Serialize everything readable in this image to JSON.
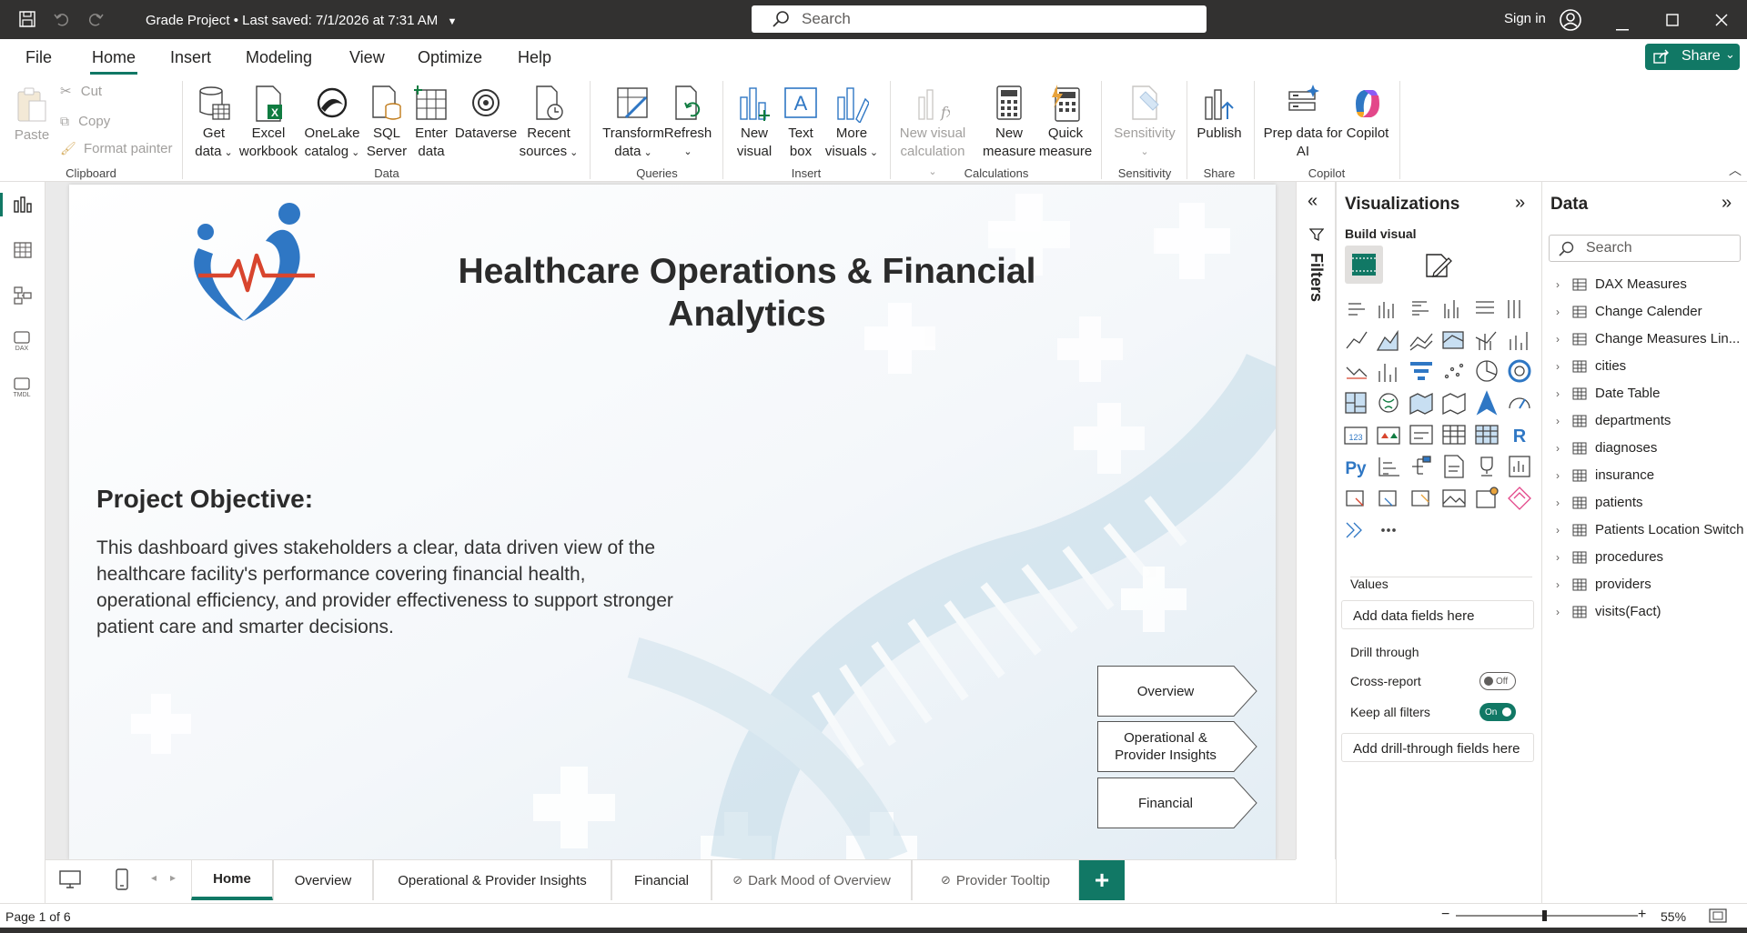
{
  "titlebar": {
    "doc_title": "Grade Project",
    "saved": "Last saved: 7/1/2026 at 7:31 AM",
    "search_placeholder": "Search",
    "signin": "Sign in"
  },
  "menu": [
    "File",
    "Home",
    "Insert",
    "Modeling",
    "View",
    "Optimize",
    "Help"
  ],
  "share_label": "Share",
  "ribbon": {
    "clipboard": {
      "paste": "Paste",
      "cut": "Cut",
      "copy": "Copy",
      "format_painter": "Format painter",
      "group": "Clipboard"
    },
    "data": {
      "get_data": [
        "Get",
        "data"
      ],
      "excel": [
        "Excel",
        "workbook"
      ],
      "onelake": [
        "OneLake",
        "catalog"
      ],
      "sql": [
        "SQL",
        "Server"
      ],
      "enter": [
        "Enter",
        "data"
      ],
      "dataverse": "Dataverse",
      "recent": [
        "Recent",
        "sources"
      ],
      "group": "Data"
    },
    "queries": {
      "transform": [
        "Transform",
        "data"
      ],
      "refresh": "Refresh",
      "group": "Queries"
    },
    "insert": {
      "new_visual": [
        "New",
        "visual"
      ],
      "text_box": [
        "Text",
        "box"
      ],
      "more_visuals": [
        "More",
        "visuals"
      ],
      "group": "Insert"
    },
    "calculations": {
      "new_visual_calc": [
        "New visual",
        "calculation"
      ],
      "new_measure": [
        "New",
        "measure"
      ],
      "quick_measure": [
        "Quick",
        "measure"
      ],
      "group": "Calculations"
    },
    "sensitivity": {
      "label": "Sensitivity",
      "group": "Sensitivity"
    },
    "share": {
      "publish": "Publish",
      "group": "Share"
    },
    "copilot": {
      "prep": [
        "Prep data for",
        "AI"
      ],
      "copilot": "Copilot",
      "group": "Copilot"
    }
  },
  "report": {
    "title_line1": "Healthcare Operations & Financial",
    "title_line2": "Analytics",
    "objective_heading": "Project Objective:",
    "objective_body": "This dashboard gives stakeholders a clear, data driven view of the healthcare facility's performance covering financial health, operational efficiency, and provider effectiveness to support stronger patient care and smarter decisions.",
    "nav": [
      "Overview",
      "Operational & Provider Insights",
      "Financial"
    ],
    "nav_line": [
      "Operational &",
      "Provider Insights"
    ]
  },
  "tabs": [
    "Home",
    "Overview",
    "Operational & Provider Insights",
    "Financial",
    "Dark Mood of Overview",
    "Provider Tooltip"
  ],
  "active_tab": "Home",
  "status": {
    "page": "Page 1 of 6",
    "zoom": "55%"
  },
  "filters_label": "Filters",
  "visualizations": {
    "title": "Visualizations",
    "build_visual": "Build visual",
    "values": "Values",
    "values_placeholder": "Add data fields here",
    "drill_through": "Drill through",
    "cross_report": "Cross-report",
    "cross_report_state": "Off",
    "keep_filters": "Keep all filters",
    "keep_filters_state": "On",
    "drill_placeholder": "Add drill-through fields here"
  },
  "data_pane": {
    "title": "Data",
    "search_placeholder": "Search",
    "tables": [
      "DAX Measures",
      "Change Calender",
      "Change Measures Lin...",
      "cities",
      "Date Table",
      "departments",
      "diagnoses",
      "insurance",
      "patients",
      "Patients Location Switch",
      "procedures",
      "providers",
      "visits(Fact)"
    ]
  },
  "colors": {
    "accent": "#117865",
    "titlebar": "#323130",
    "brand_blue": "#2f77c4",
    "brand_red": "#d8452e"
  }
}
